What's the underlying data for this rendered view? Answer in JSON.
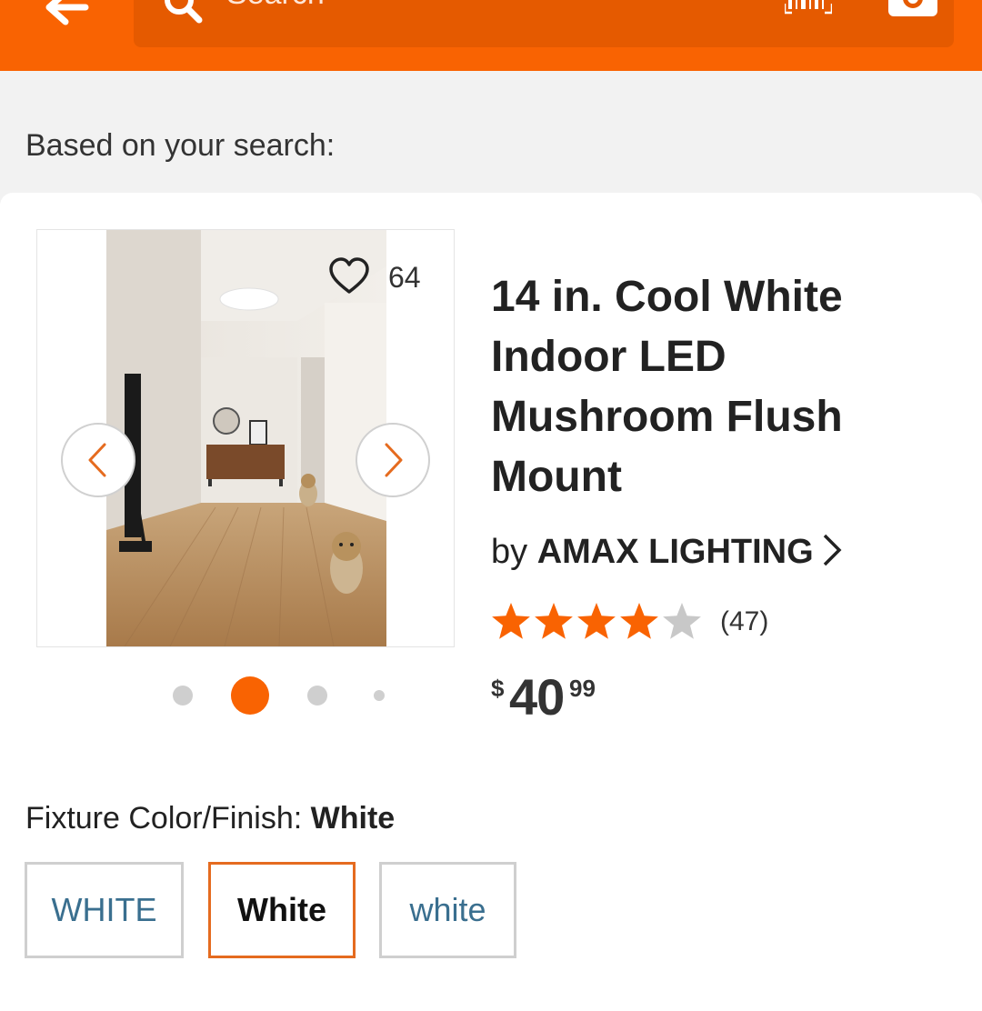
{
  "header": {
    "search_placeholder": "Search",
    "back_icon": "back-arrow-icon",
    "search_icon": "search-icon",
    "barcode_icon": "barcode-scan-icon",
    "camera_icon": "camera-icon",
    "brand_color": "#f96302"
  },
  "section_label": "Based on your search:",
  "product": {
    "favorite_count": "64",
    "title": "14 in. Cool White Indoor LED Mushroom Flush Mount",
    "brand_prefix": "by",
    "brand_name": "AMAX LIGHTING",
    "rating": 4,
    "rating_max": 5,
    "review_count": "(47)",
    "price_currency": "$",
    "price_dollars": "40",
    "price_cents": "99",
    "carousel": {
      "total_slides": 4,
      "active_index": 1
    }
  },
  "finish": {
    "label": "Fixture Color/Finish:",
    "selected_value": "White",
    "options": [
      {
        "label": "WHITE",
        "selected": false
      },
      {
        "label": "White",
        "selected": true
      },
      {
        "label": "white",
        "selected": false
      }
    ]
  },
  "colors": {
    "accent": "#f96302",
    "star_filled": "#f96302",
    "star_empty": "#c8c8c8",
    "swatch_selected_border": "#e56b1f",
    "link_text": "#3a6f8f"
  }
}
